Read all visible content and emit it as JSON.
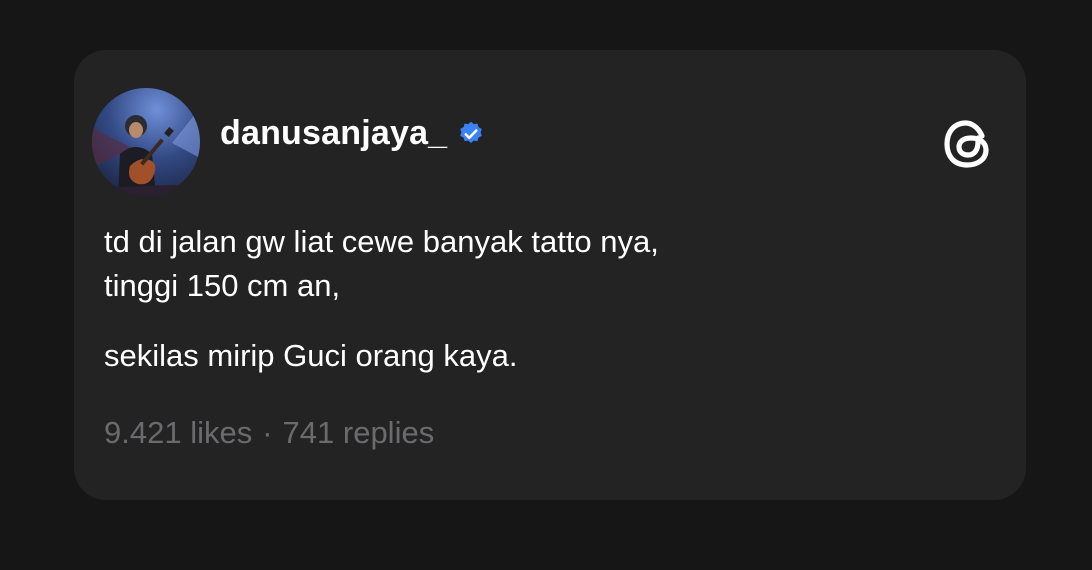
{
  "post": {
    "username": "danusanjaya_",
    "lines": [
      "td di jalan gw liat cewe banyak tatto nya,",
      "tinggi 150 cm an,",
      "sekilas mirip Guci orang kaya."
    ],
    "likes": "9.421 likes",
    "separator": "·",
    "replies": "741 replies"
  },
  "icons": {
    "verified": "verified-badge-icon",
    "app_logo": "threads-logo-icon"
  },
  "colors": {
    "background": "#161617",
    "card": "#232324",
    "text": "#ffffff",
    "muted": "#6b6b6e",
    "verified": "#3b82f6"
  }
}
